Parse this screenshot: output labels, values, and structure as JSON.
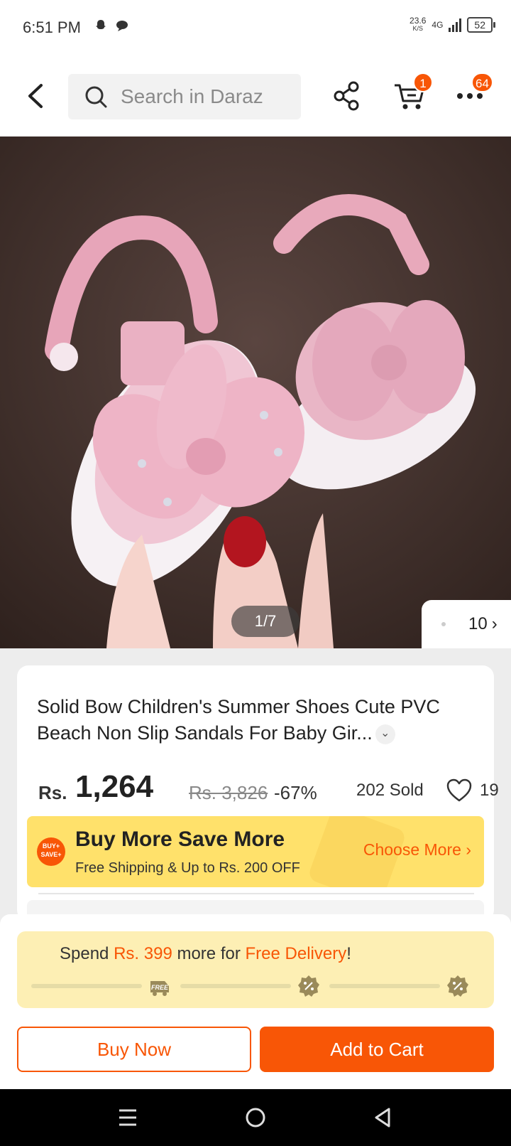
{
  "status_bar": {
    "time": "6:51 PM",
    "net_speed": "23.6",
    "net_unit": "K/S",
    "network": "4G",
    "battery": "52"
  },
  "header": {
    "search_placeholder": "Search in Daraz",
    "cart_count": "1",
    "more_count": "64",
    "icons": [
      "back-icon",
      "search-icon",
      "share-icon",
      "cart-icon",
      "more-icon"
    ]
  },
  "gallery": {
    "counter": "1/7",
    "thumb_count": "10"
  },
  "product": {
    "title": "Solid Bow Children's Summer Shoes Cute PVC Beach Non Slip Sandals For Baby Gir...",
    "currency": "Rs.",
    "price": "1,264",
    "original_price": "Rs. 3,826",
    "discount": "-67%",
    "sold": "202 Sold",
    "likes": "19"
  },
  "promo": {
    "badge_top": "BUY+",
    "badge_bottom": "SAVE+",
    "heading": "Buy More Save More",
    "subtext": "Free Shipping & Up to Rs. 200 OFF",
    "link": "Choose More"
  },
  "delivery": {
    "prefix": "Spend",
    "amount": "Rs. 399",
    "middle": "more for",
    "goal": "Free Delivery",
    "suffix": "!",
    "milestone_label": "FREE"
  },
  "actions": {
    "buy_now": "Buy Now",
    "add_to_cart": "Add to Cart"
  },
  "colors": {
    "accent": "#f85606",
    "promo_bg": "#ffe16b",
    "delivery_bg": "#fdefb4"
  }
}
